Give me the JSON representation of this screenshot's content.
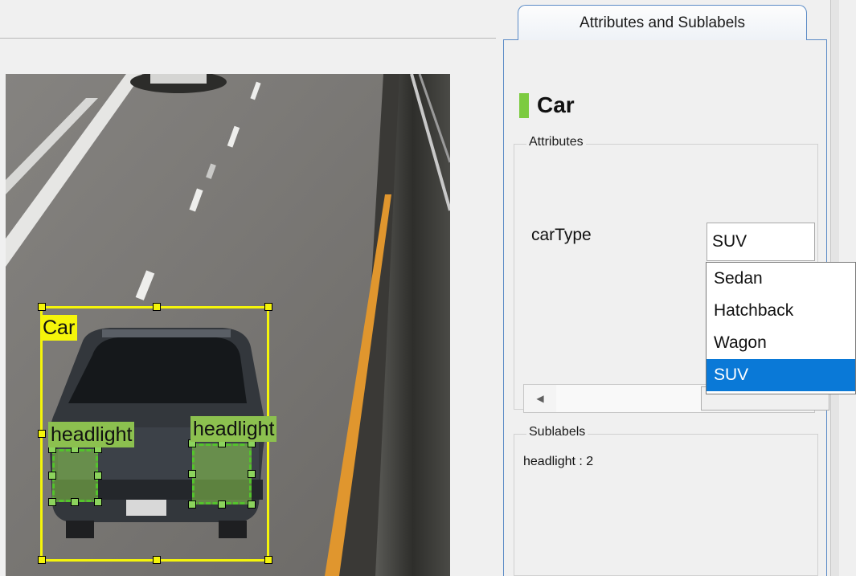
{
  "viewer": {
    "rois": [
      {
        "label": "Car",
        "color": "#f5f50a"
      },
      {
        "label": "headlight",
        "color": "#8cc04f"
      },
      {
        "label": "headlight",
        "color": "#8cc04f"
      }
    ]
  },
  "panel": {
    "tab_label": "Attributes and Sublabels",
    "label_name": "Car",
    "label_color": "#7ccb40",
    "attributes_group_title": "Attributes",
    "attribute": {
      "name": "carType",
      "selected_value": "SUV",
      "options": [
        "Sedan",
        "Hatchback",
        "Wagon",
        "SUV"
      ]
    },
    "sublabels_group_title": "Sublabels",
    "sublabel_summary": "headlight : 2"
  },
  "colors": {
    "accent": "#0a79d7",
    "tab_border": "#5b8bc6"
  },
  "icons": {
    "scroll_left": "triangle-left-icon"
  }
}
